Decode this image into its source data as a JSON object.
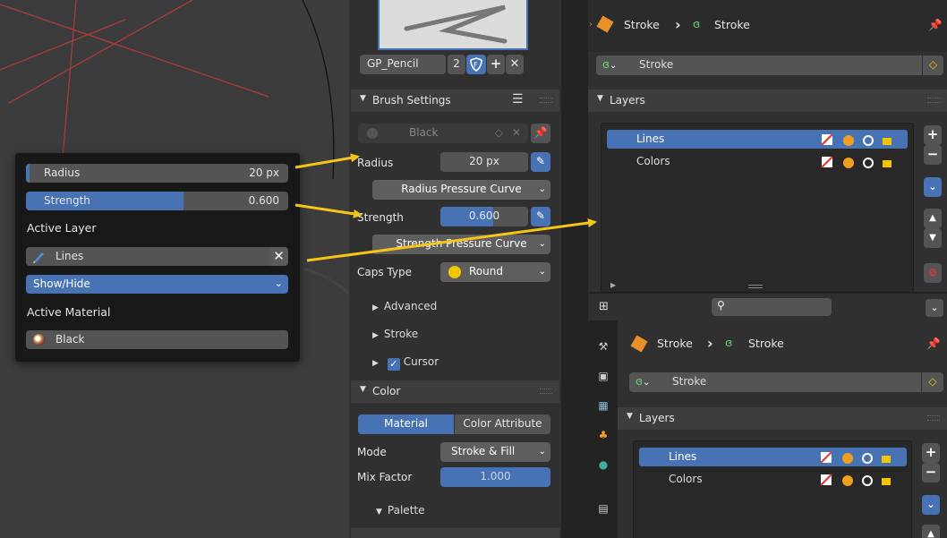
{
  "popover": {
    "radius_label": "Radius",
    "radius_value": "20 px",
    "strength_label": "Strength",
    "strength_value": "0.600",
    "strength_fraction": 0.6,
    "active_layer_heading": "Active Layer",
    "active_layer_value": "Lines",
    "show_hide_value": "Show/Hide",
    "active_material_heading": "Active Material",
    "active_material_value": "Black"
  },
  "brush_panel": {
    "brush_name": "GP_Pencil",
    "user_count": "2",
    "brush_settings_title": "Brush Settings",
    "material_value": "Black",
    "radius_label": "Radius",
    "radius_value": "20 px",
    "radius_curve_label": "Radius Pressure Curve",
    "strength_label": "Strength",
    "strength_value": "0.600",
    "strength_curve_label": "Strength Pressure Curve",
    "caps_label": "Caps Type",
    "caps_value": "Round",
    "advanced_label": "Advanced",
    "stroke_label": "Stroke",
    "cursor_label": "Cursor",
    "color_title": "Color",
    "tab_material": "Material",
    "tab_color_attribute": "Color Attribute",
    "mode_label": "Mode",
    "mode_value": "Stroke & Fill",
    "mix_label": "Mix Factor",
    "mix_value": "1.000",
    "palette_label": "Palette"
  },
  "top_outliner": {
    "crumb_object": "Stroke",
    "crumb_data": "Stroke",
    "data_field": "Stroke",
    "layers_title": "Layers",
    "layers": [
      "Lines",
      "Colors"
    ]
  },
  "bottom_properties": {
    "crumb_object": "Stroke",
    "crumb_data": "Stroke",
    "data_field": "Stroke",
    "layers_title": "Layers",
    "layers": [
      "Lines",
      "Colors"
    ]
  },
  "colors": {
    "accent": "#4772b3",
    "arrow": "#f5c518",
    "panel": "#303030",
    "header": "#3d3d3d",
    "popover": "#181818"
  }
}
